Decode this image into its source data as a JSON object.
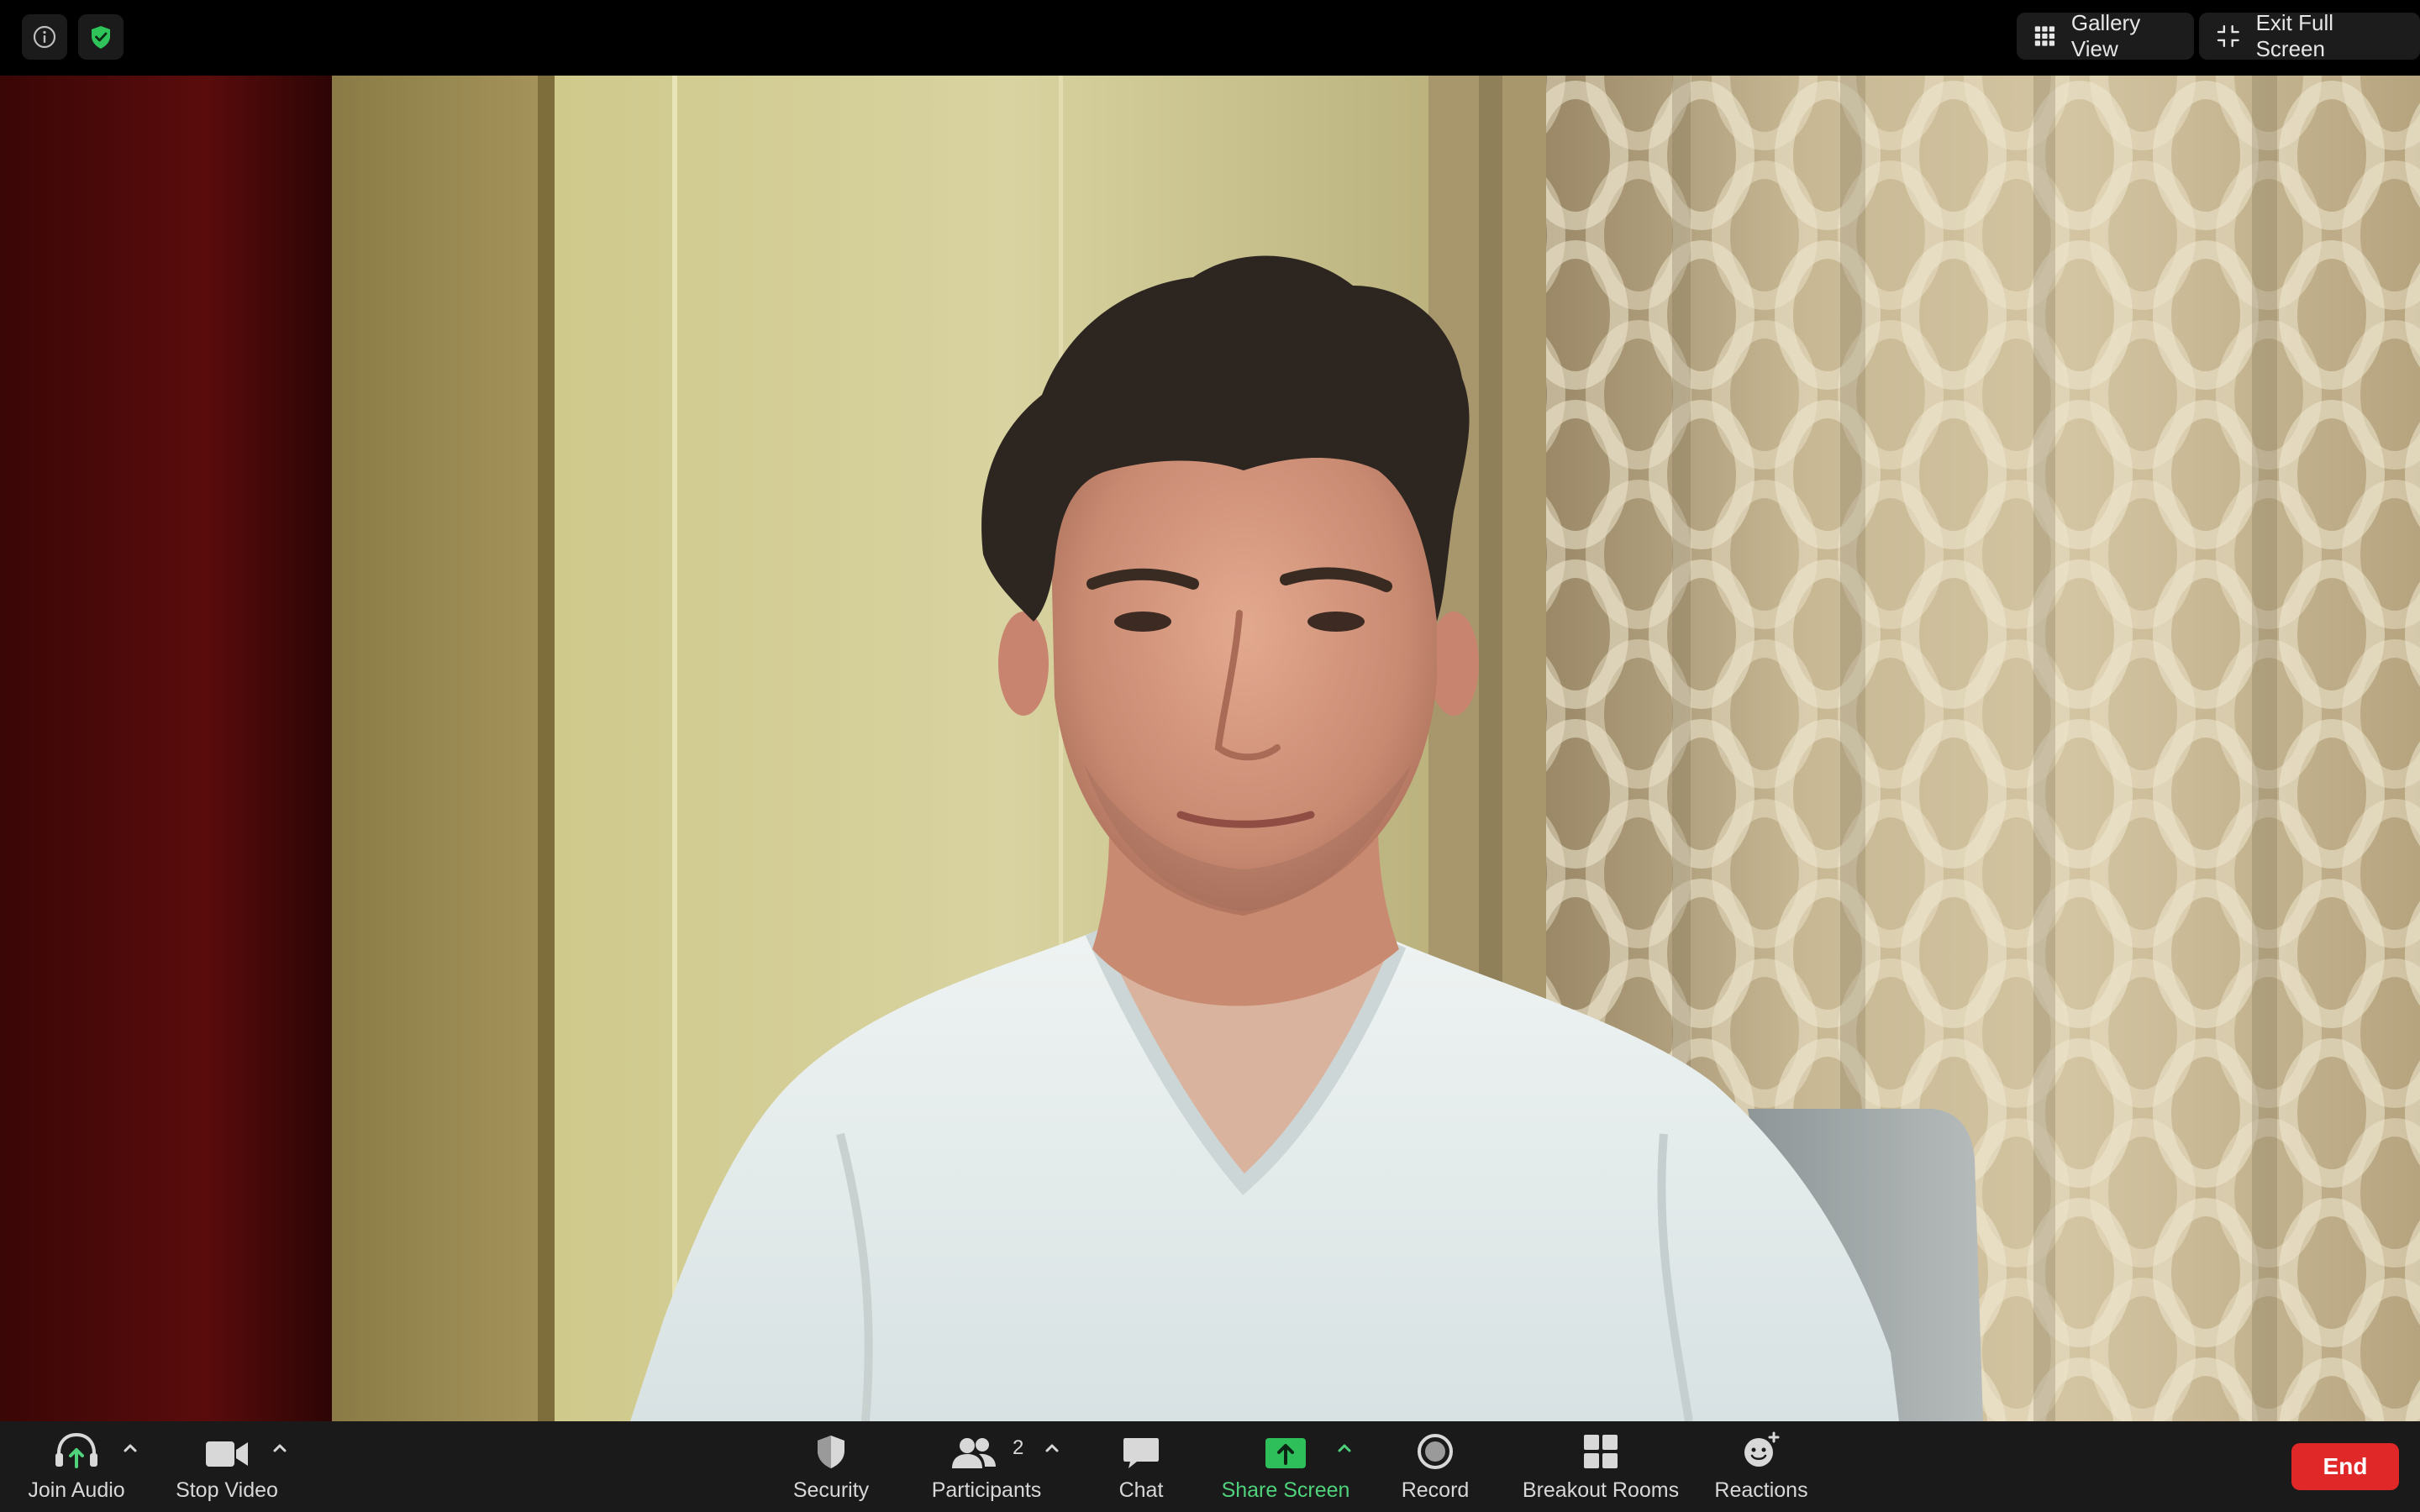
{
  "window": {
    "info_icon": "info-icon",
    "security_status_icon": "shield-check-icon",
    "gallery_view_label": "Gallery View",
    "exit_full_screen_label": "Exit Full Screen"
  },
  "video": {
    "description_icon": "participant-video"
  },
  "toolbar": {
    "join_audio": "Join Audio",
    "stop_video": "Stop Video",
    "security": "Security",
    "participants": "Participants",
    "participants_count": "2",
    "chat": "Chat",
    "share_screen": "Share Screen",
    "record": "Record",
    "breakout_rooms": "Breakout Rooms",
    "reactions": "Reactions",
    "end": "End"
  },
  "colors": {
    "toolbar_bg": "#1a1a1a",
    "share_green": "#4fd27b",
    "end_red": "#e02828",
    "shield_green": "#2ec45a"
  }
}
